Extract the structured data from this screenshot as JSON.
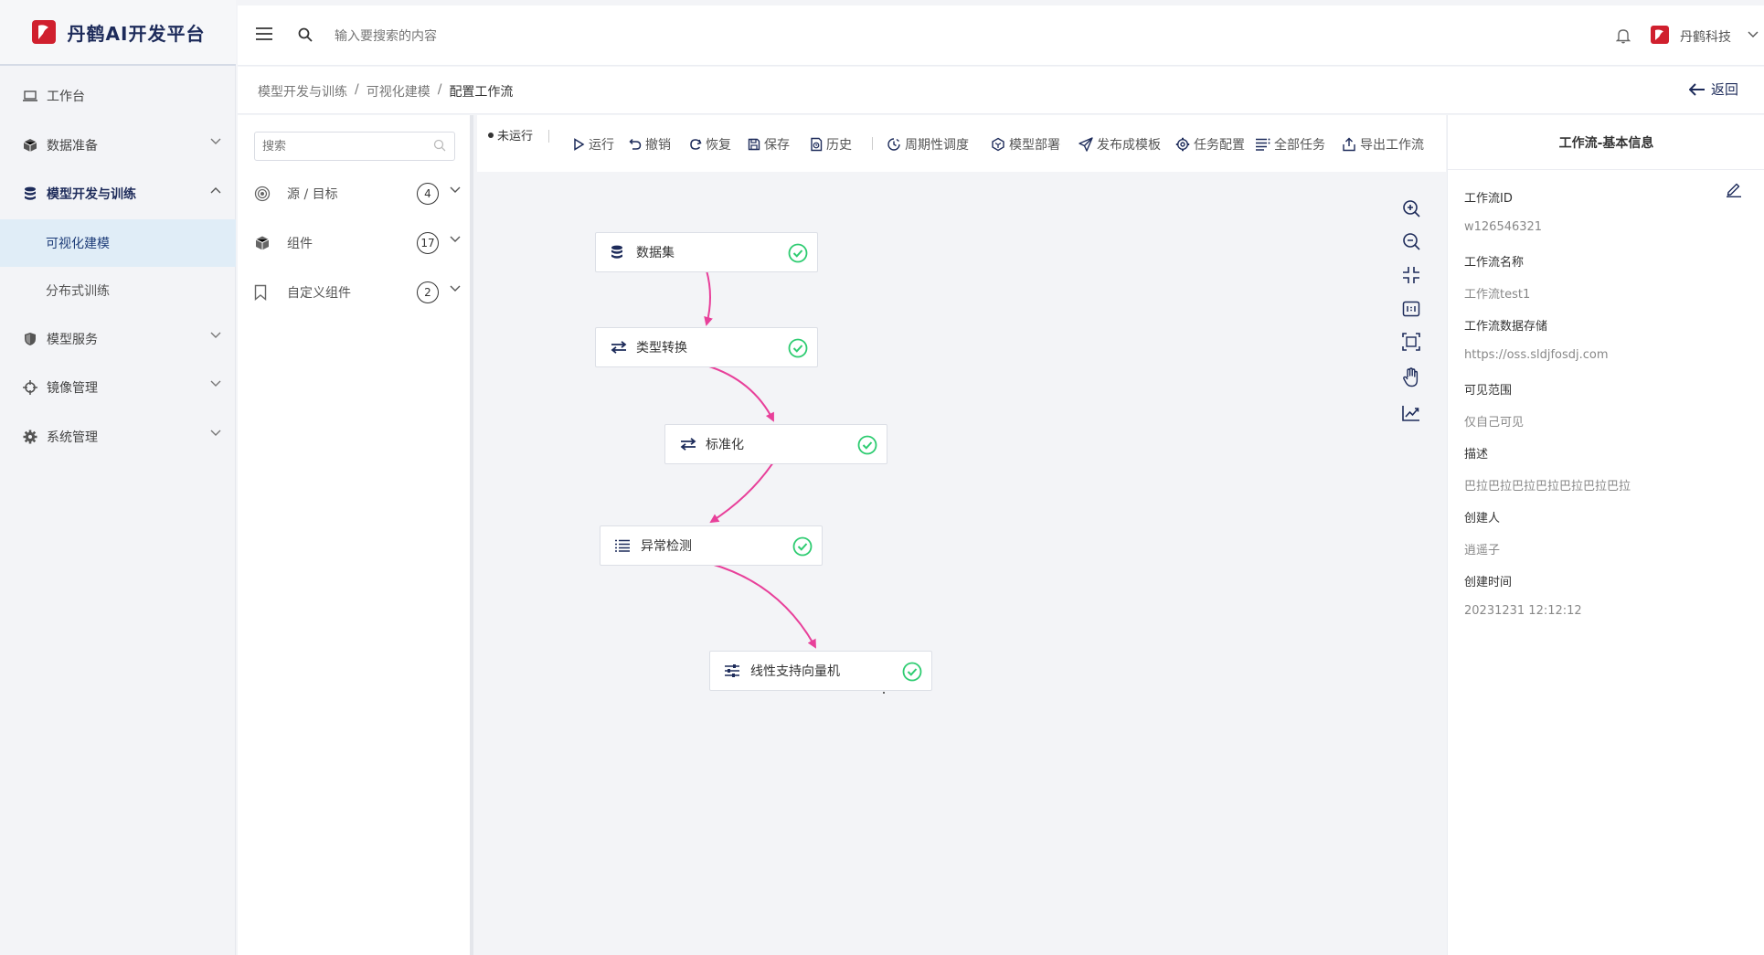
{
  "brand": {
    "title": "丹鹤AI开发平台",
    "accent": "#d0202e"
  },
  "header": {
    "search_placeholder": "输入要搜索的内容",
    "user_name": "丹鹤科技"
  },
  "sidebar": {
    "items": [
      {
        "label": "工作台",
        "icon": "laptop-icon"
      },
      {
        "label": "数据准备",
        "icon": "cube-icon"
      },
      {
        "label": "模型开发与训练",
        "icon": "database-icon",
        "expanded": true,
        "children": [
          {
            "label": "可视化建模",
            "selected": true
          },
          {
            "label": "分布式训练"
          }
        ]
      },
      {
        "label": "模型服务",
        "icon": "shield-icon"
      },
      {
        "label": "镜像管理",
        "icon": "crosshair-icon"
      },
      {
        "label": "系统管理",
        "icon": "gear-icon"
      }
    ]
  },
  "breadcrumb": {
    "items": [
      "模型开发与训练",
      "可视化建模",
      "配置工作流"
    ],
    "separator": "/"
  },
  "back_label": "返回",
  "components": {
    "search_placeholder": "搜索",
    "categories": [
      {
        "label": "源 / 目标",
        "count": "4",
        "icon": "target-icon"
      },
      {
        "label": "组件",
        "count": "17",
        "icon": "cube-icon"
      },
      {
        "label": "自定义组件",
        "count": "2",
        "icon": "bookmark-icon"
      }
    ]
  },
  "toolbar": {
    "status": "未运行",
    "actions": [
      {
        "label": "运行",
        "icon": "play-icon"
      },
      {
        "label": "撤销",
        "icon": "undo-icon"
      },
      {
        "label": "恢复",
        "icon": "redo-icon"
      },
      {
        "label": "保存",
        "icon": "save-icon"
      },
      {
        "label": "历史",
        "icon": "history-icon"
      },
      {
        "label": "周期性调度",
        "icon": "schedule-icon"
      },
      {
        "label": "模型部署",
        "icon": "deploy-icon"
      },
      {
        "label": "发布成模板",
        "icon": "send-icon"
      },
      {
        "label": "任务配置",
        "icon": "settings-icon"
      },
      {
        "label": "全部任务",
        "icon": "list-icon"
      },
      {
        "label": "导出工作流",
        "icon": "export-icon"
      }
    ]
  },
  "workflow": {
    "nodes": [
      {
        "label": "数据集",
        "icon": "database-icon",
        "status": "success"
      },
      {
        "label": "类型转换",
        "icon": "swap-icon",
        "status": "success"
      },
      {
        "label": "标准化",
        "icon": "swap-icon",
        "status": "success"
      },
      {
        "label": "异常检测",
        "icon": "list-icon",
        "status": "success"
      },
      {
        "label": "线性支持向量机",
        "icon": "sliders-icon",
        "status": "success"
      }
    ],
    "edge_color": "#e8409a",
    "success_color": "#2ecc71"
  },
  "canvas_controls": [
    "zoom-in-icon",
    "zoom-out-icon",
    "fit-icon",
    "actual-size-icon",
    "frame-icon",
    "hand-icon",
    "chart-icon"
  ],
  "info": {
    "title": "工作流-基本信息",
    "fields": [
      {
        "label": "工作流ID",
        "value": "w126546321"
      },
      {
        "label": "工作流名称",
        "value": "工作流test1"
      },
      {
        "label": "工作流数据存储",
        "value": "https://oss.sldjfosdj.com"
      },
      {
        "label": "可见范围",
        "value": "仅自己可见"
      },
      {
        "label": "描述",
        "value": "巴拉巴拉巴拉巴拉巴拉巴拉巴拉"
      },
      {
        "label": "创建人",
        "value": "逍遥子"
      },
      {
        "label": "创建时间",
        "value": "20231231 12:12:12"
      }
    ]
  }
}
